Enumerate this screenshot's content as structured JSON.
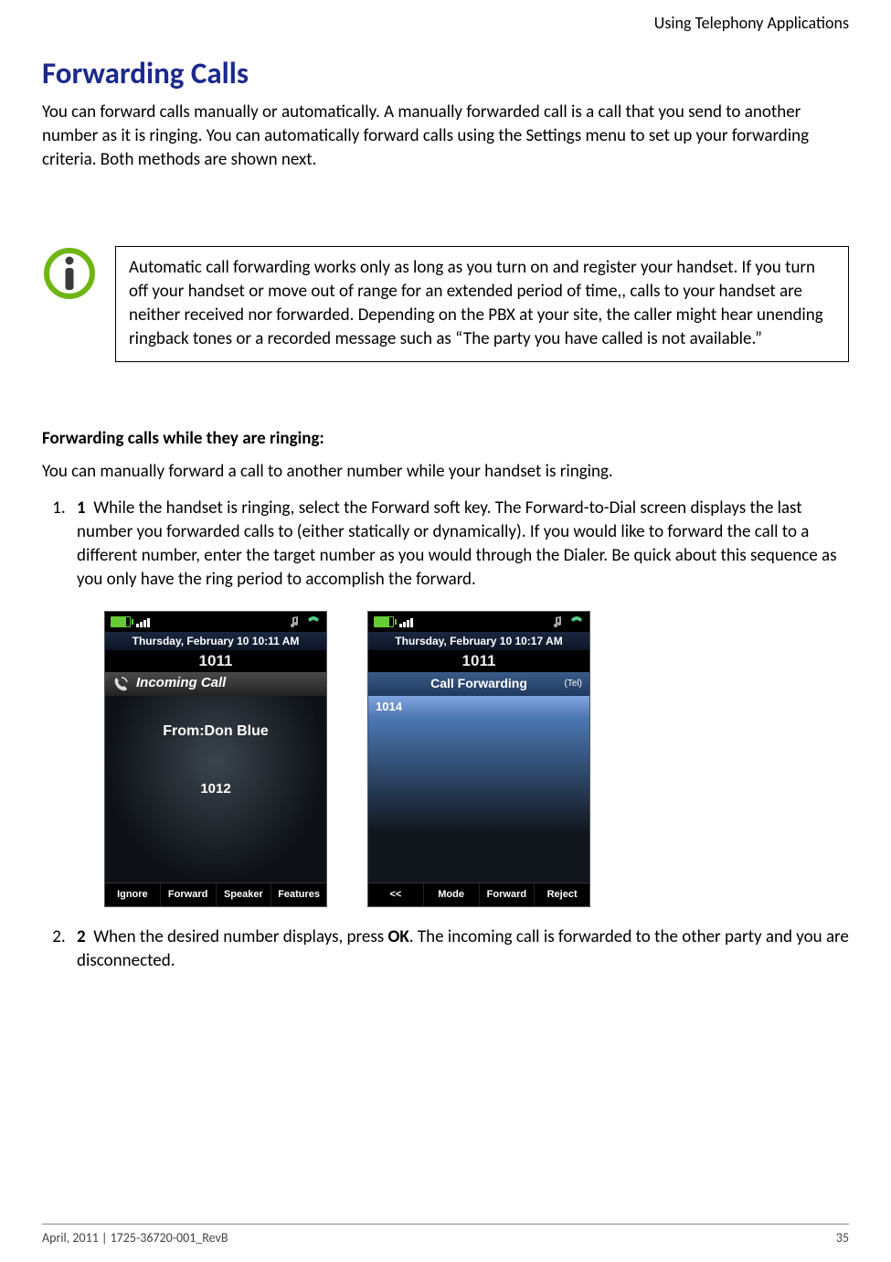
{
  "header": {
    "section": "Using Telephony Applications"
  },
  "title": "Forwarding Calls",
  "intro": "You can forward calls manually or automatically. A manually forwarded call is a call that you send to another number as it is ringing. You can automatically forward calls using the Settings menu to set up your forwarding criteria. Both methods are shown next.",
  "note": "Automatic call forwarding works only as long as you turn on and register your handset. If you turn off your handset or move out of range for an extended period of time,, calls to your handset are neither received nor forwarded. Depending on the PBX at your site, the caller might hear unending ringback tones or a recorded message such as “The party you have called is not available.”",
  "subhead": "Forwarding calls while they are ringing:",
  "subintro": "You can manually forward a call to another number while your handset is ringing.",
  "steps": {
    "s1_num": "1",
    "s1": "While the handset is ringing, select the Forward soft key. The Forward-to-Dial screen displays the last number you forwarded calls to (either statically or dynamically). If you would like to forward the call to a different number, enter the target number as you would through the Dialer. Be quick about this sequence as you only have the ring period to accomplish the forward.",
    "s2_num": "2",
    "s2a": "When the desired number displays, press ",
    "s2b": "OK",
    "s2c": ". The incoming call is forwarded to the other party and you are disconnected."
  },
  "phone1": {
    "date": "Thursday, February 10 10:11 AM",
    "ext": "1011",
    "status": "Incoming Call",
    "from_label": "From:Don Blue",
    "from_num": "1012",
    "keys": [
      "Ignore",
      "Forward",
      "Speaker",
      "Features"
    ]
  },
  "phone2": {
    "date": "Thursday, February 10 10:17 AM",
    "ext": "1011",
    "status": "Call Forwarding",
    "tel": "(Tel)",
    "entry": "1014",
    "keys": [
      "<<",
      "Mode",
      "Forward",
      "Reject"
    ]
  },
  "footer": {
    "left": "April, 2011  |  1725-36720-001_RevB",
    "right": "35"
  }
}
